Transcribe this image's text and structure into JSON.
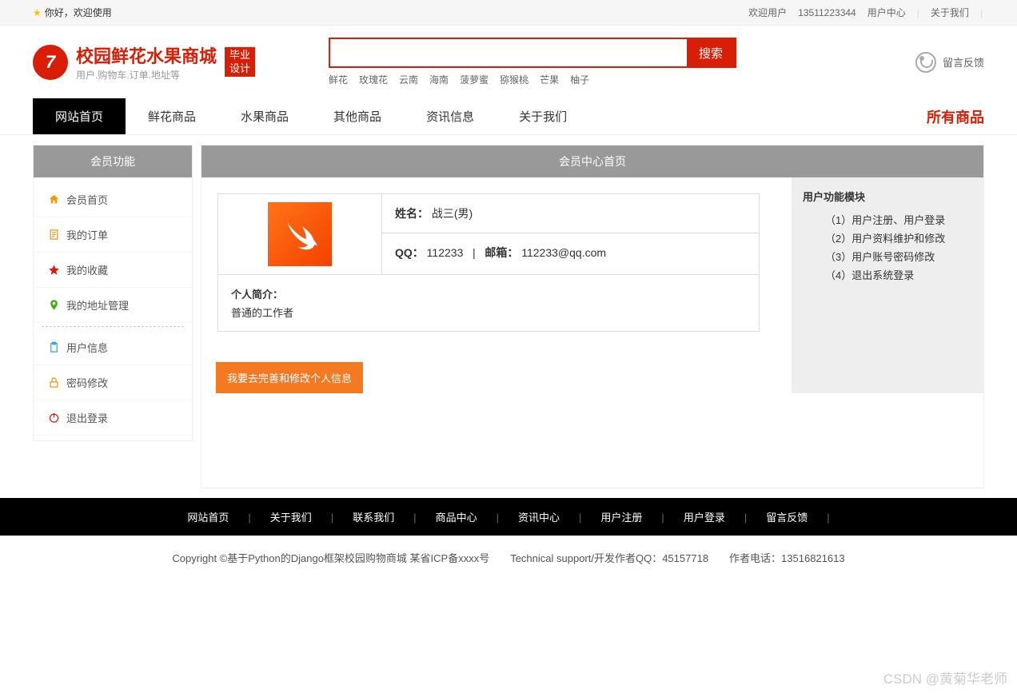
{
  "topbar": {
    "hello": "你好，欢迎使用",
    "welcome_user": "欢迎用户",
    "phone": "13511223344",
    "user_center": "用户中心",
    "about_us": "关于我们"
  },
  "logo": {
    "title": "校园鲜花水果商城",
    "subtitle": "用户.购物车.订单.地址等",
    "badge_line1": "毕业",
    "badge_line2": "设计"
  },
  "search": {
    "button": "搜索",
    "hotwords": [
      "鲜花",
      "玫瑰花",
      "云南",
      "海南",
      "菠萝蜜",
      "猕猴桃",
      "芒果",
      "柚子"
    ]
  },
  "feedback": "留言反馈",
  "nav": {
    "items": [
      "网站首页",
      "鲜花商品",
      "水果商品",
      "其他商品",
      "资讯信息",
      "关于我们"
    ],
    "right": "所有商品"
  },
  "sidebar": {
    "title": "会员功能",
    "items": [
      {
        "label": "会员首页",
        "icon": "home",
        "color": "#f39800"
      },
      {
        "label": "我的订单",
        "icon": "order",
        "color": "#f39800"
      },
      {
        "label": "我的收藏",
        "icon": "star",
        "color": "#d81e06"
      },
      {
        "label": "我的地址管理",
        "icon": "pin",
        "color": "#3eaf0e"
      }
    ],
    "items2": [
      {
        "label": "用户信息",
        "icon": "clip",
        "color": "#17b5dc"
      },
      {
        "label": "密码修改",
        "icon": "lock",
        "color": "#f39800"
      },
      {
        "label": "退出登录",
        "icon": "power",
        "color": "#d81e06"
      }
    ]
  },
  "content": {
    "title": "会员中心首页",
    "name_label": "姓名：",
    "name_value": "战三(男)",
    "qq_label": "QQ：",
    "qq_value": "112233",
    "email_label": "邮箱：",
    "email_value": "112233@qq.com",
    "intro_label": "个人简介：",
    "intro_value": "普通的工作者",
    "edit_btn": "我要去完善和修改个人信息"
  },
  "right_panel": {
    "title": "用户功能模块",
    "items": [
      "（1）用户注册、用户登录",
      "（2）用户资料维护和修改",
      "（3）用户账号密码修改",
      "（4）退出系统登录"
    ]
  },
  "footer": {
    "links": [
      "网站首页",
      "关于我们",
      "联系我们",
      "商品中心",
      "资讯中心",
      "用户注册",
      "用户登录",
      "留言反馈"
    ],
    "copyright": "Copyright ©基于Python的Django框架校园购物商城 某省ICP备xxxx号　　Technical support/开发作者QQ：45157718　　作者电话：13516821613"
  },
  "watermark": "CSDN @黄菊华老师"
}
